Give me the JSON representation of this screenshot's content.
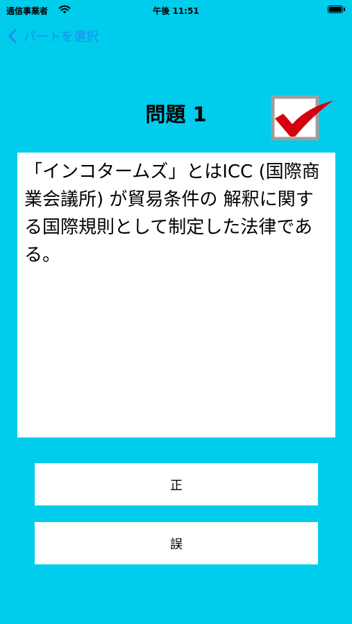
{
  "status_bar": {
    "carrier": "通信事業者",
    "time": "午後 11:51",
    "wifi_icon": "wifi-icon",
    "battery_icon": "battery-icon"
  },
  "nav": {
    "back_label": "パートを選択",
    "back_icon": "chevron-left-icon",
    "accent_color": "#1E8CF5"
  },
  "question": {
    "title": "問題 1",
    "text": "「インコタームズ」とはICC (国際商業会議所) が貿易条件の 解釈に関する国際規則として制定した法律である。",
    "check_icon": "checkmark-icon"
  },
  "answers": {
    "true_label": "正",
    "false_label": "誤"
  },
  "colors": {
    "background": "#00CCEB",
    "card": "#FFFFFF",
    "check_red": "#D4000F"
  }
}
